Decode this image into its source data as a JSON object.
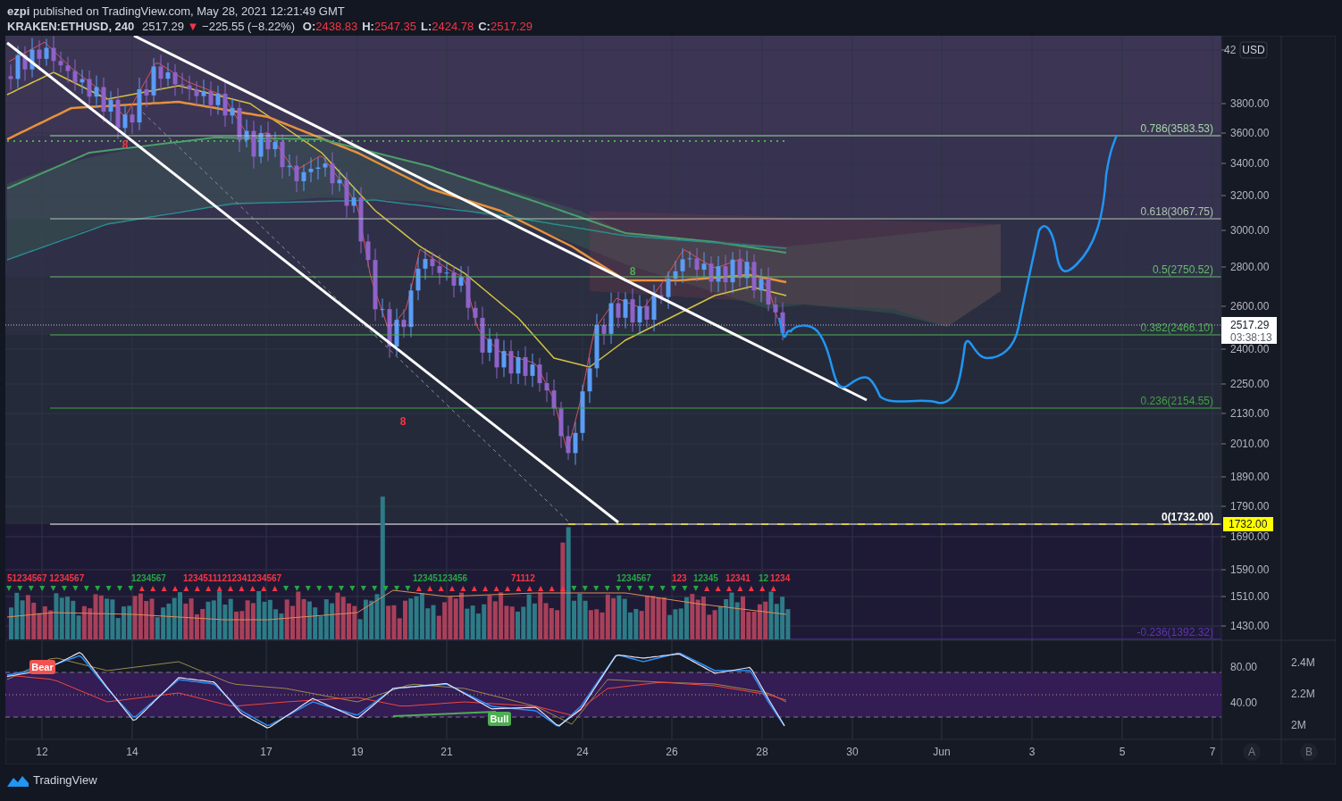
{
  "header": {
    "author": "ezpi",
    "published": "published on TradingView.com, May 28, 2021 12:21:49 GMT"
  },
  "symbol_bar": {
    "symbol": "KRAKEN:ETHUSD, 240",
    "last": "2517.29",
    "direction": "▼",
    "change": "−225.55 (−8.22%)",
    "ohlc": [
      {
        "label": "O:",
        "value": "2438.83"
      },
      {
        "label": "H:",
        "value": "2547.35"
      },
      {
        "label": "L:",
        "value": "2424.78"
      },
      {
        "label": "C:",
        "value": "2517.29"
      }
    ]
  },
  "price_axis": {
    "currency": "USD",
    "ticks": [
      "42",
      "3800.00",
      "3600.00",
      "3400.00",
      "3200.00",
      "3000.00",
      "2800.00",
      "2600.00",
      "2400.00",
      "2250.00",
      "2130.00",
      "2010.00",
      "1890.00",
      "1790.00",
      "1690.00",
      "1590.00",
      "1510.00",
      "1430.00"
    ],
    "last_price": "2517.29",
    "countdown": "03:38:13",
    "low_marker": "1732.00"
  },
  "fib_levels": [
    {
      "label": "0.786(3583.53)",
      "color": "#a5d6a7"
    },
    {
      "label": "0.618(3067.75)",
      "color": "#b0c4b1"
    },
    {
      "label": "0.5(2750.52)",
      "color": "#66bb6a"
    },
    {
      "label": "0.382(2466.10)",
      "color": "#4caf50"
    },
    {
      "label": "0.236(2154.55)",
      "color": "#43a047"
    },
    {
      "label": "0(1732.00)",
      "color": "#ffffff"
    },
    {
      "label": "-0.236(1392.32)",
      "color": "#5e35b1"
    }
  ],
  "candle_marks": [
    {
      "text": "8",
      "color": "#f23645"
    },
    {
      "text": "8",
      "color": "#4caf50"
    },
    {
      "text": "8",
      "color": "#f23645"
    }
  ],
  "count_sequence": [
    {
      "text": "51234567 1234567",
      "color": "#f23645"
    },
    {
      "text": "1234567",
      "color": "#26a643"
    },
    {
      "text": "12345111212341234567",
      "color": "#f23645"
    },
    {
      "text": "12345123456",
      "color": "#26a643"
    },
    {
      "text": "71112",
      "color": "#f23645"
    },
    {
      "text": "1234567",
      "color": "#26a643"
    },
    {
      "text": "123",
      "color": "#f23645"
    },
    {
      "text": "12345",
      "color": "#26a643"
    },
    {
      "text": "12341",
      "color": "#f23645"
    },
    {
      "text": "12",
      "color": "#26a643"
    },
    {
      "text": "1234",
      "color": "#f23645"
    }
  ],
  "oscillator": {
    "signals": [
      {
        "kind": "bear",
        "label": "Bear"
      },
      {
        "kind": "bull",
        "label": "Bull"
      }
    ],
    "ticks": [
      "80.00",
      "40.00"
    ],
    "volume_ticks": [
      "2.4M",
      "2.2M",
      "2M"
    ]
  },
  "time_axis": {
    "ticks": [
      "12",
      "14",
      "17",
      "19",
      "21",
      "24",
      "26",
      "28",
      "30",
      "Jun",
      "3",
      "5",
      "7"
    ],
    "scale_buttons": [
      "A",
      "B"
    ]
  },
  "footer": {
    "brand": "TradingView"
  }
}
